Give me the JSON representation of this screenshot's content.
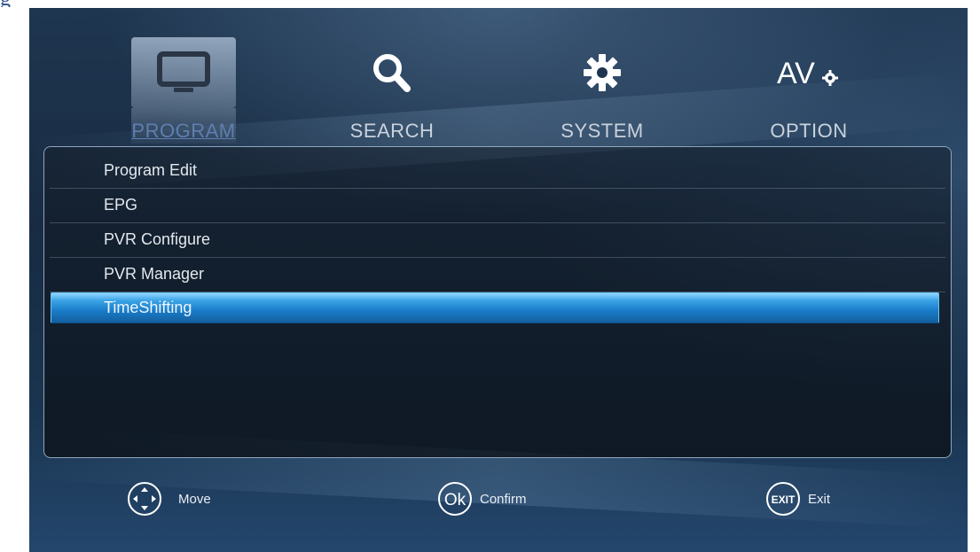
{
  "caption": "g",
  "tabs": [
    {
      "label": "PROGRAM",
      "icon": "tv-monitor-icon",
      "active": true
    },
    {
      "label": "SEARCH",
      "icon": "search-icon",
      "active": false
    },
    {
      "label": "SYSTEM",
      "icon": "gear-icon",
      "active": false
    },
    {
      "label": "OPTION",
      "icon": "av-settings-icon",
      "icon_text": "AV",
      "active": false
    }
  ],
  "menu": {
    "items": [
      {
        "label": "Program Edit"
      },
      {
        "label": "EPG"
      },
      {
        "label": "PVR Configure"
      },
      {
        "label": "PVR Manager"
      },
      {
        "label": "TimeShifting"
      }
    ],
    "selected": "TimeShifting"
  },
  "footer": {
    "move": {
      "label": "Move",
      "icon": "dpad-icon"
    },
    "confirm": {
      "label": "Confirm",
      "icon": "ok-button-icon",
      "icon_text": "Ok"
    },
    "exit": {
      "label": "Exit",
      "icon": "exit-button-icon",
      "icon_text": "EXIT"
    }
  },
  "colors": {
    "selection": "#1a7cc8",
    "background": "#1f3650",
    "active_tab_label": "#5e7fb0"
  }
}
